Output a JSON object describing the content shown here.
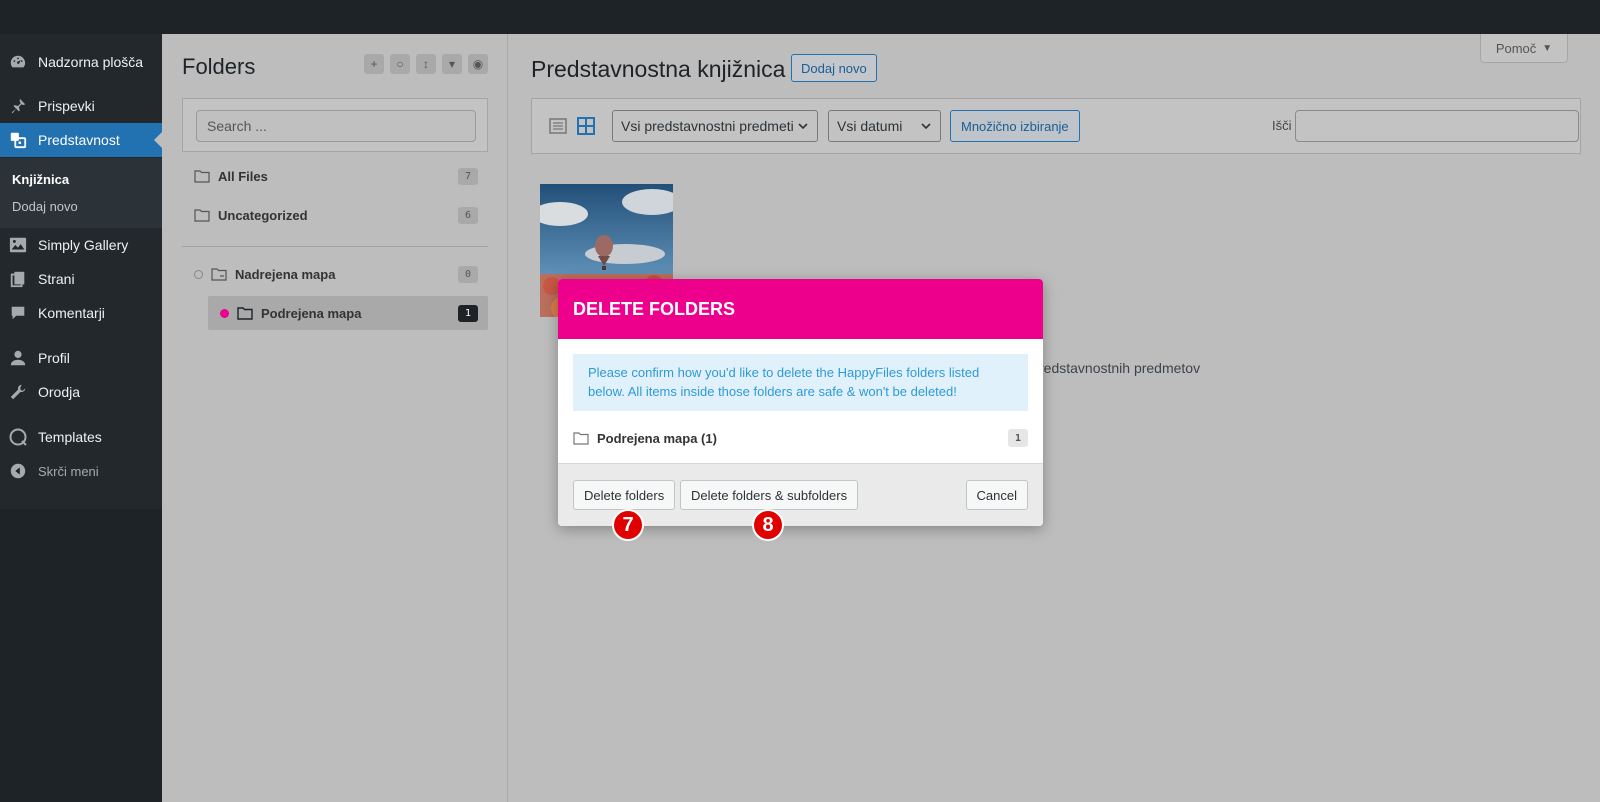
{
  "sidebar": {
    "items": [
      {
        "label": "Nadzorna plošča",
        "icon": "dashboard-icon"
      },
      {
        "label": "Prispevki",
        "icon": "pin-icon"
      },
      {
        "label": "Predstavnost",
        "icon": "media-icon"
      },
      {
        "label": "Simply Gallery",
        "icon": "gallery-icon"
      },
      {
        "label": "Strani",
        "icon": "pages-icon"
      },
      {
        "label": "Komentarji",
        "icon": "comments-icon"
      },
      {
        "label": "Profil",
        "icon": "user-icon"
      },
      {
        "label": "Orodja",
        "icon": "wrench-icon"
      },
      {
        "label": "Templates",
        "icon": "templates-icon"
      },
      {
        "label": "Skrči meni",
        "icon": "collapse-icon"
      }
    ],
    "submenu": [
      {
        "label": "Knjižnica"
      },
      {
        "label": "Dodaj novo"
      }
    ],
    "accent": "#2271b1"
  },
  "folders": {
    "title": "Folders",
    "search_placeholder": "Search ...",
    "all_files": {
      "label": "All Files",
      "count": "7"
    },
    "uncategorized": {
      "label": "Uncategorized",
      "count": "6"
    },
    "tree": [
      {
        "label": "Nadrejena mapa",
        "count": "0"
      },
      {
        "label": "Podrejena mapa",
        "count": "1",
        "color": "#ec008c"
      }
    ]
  },
  "main": {
    "help_label": "Pomoč",
    "title": "Predstavnostna knjižnica",
    "add_new_label": "Dodaj novo",
    "filter_type": "Vsi predstavnostni predmeti",
    "filter_date": "Vsi datumi",
    "bulk_select_label": "Množično izbiranje",
    "search_label": "Išči",
    "background_text": "redstavnostnih predmetov"
  },
  "modal": {
    "title": "DELETE FOLDERS",
    "notice": "Please confirm how you'd like to delete the HappyFiles folders listed below. All items inside those folders are safe & won't be deleted!",
    "folder_label": "Podrejena mapa (1)",
    "folder_count": "1",
    "delete_label": "Delete folders",
    "delete_sub_label": "Delete folders & subfolders",
    "cancel_label": "Cancel",
    "header_color": "#ec008c"
  },
  "badges": {
    "first": "7",
    "second": "8"
  }
}
